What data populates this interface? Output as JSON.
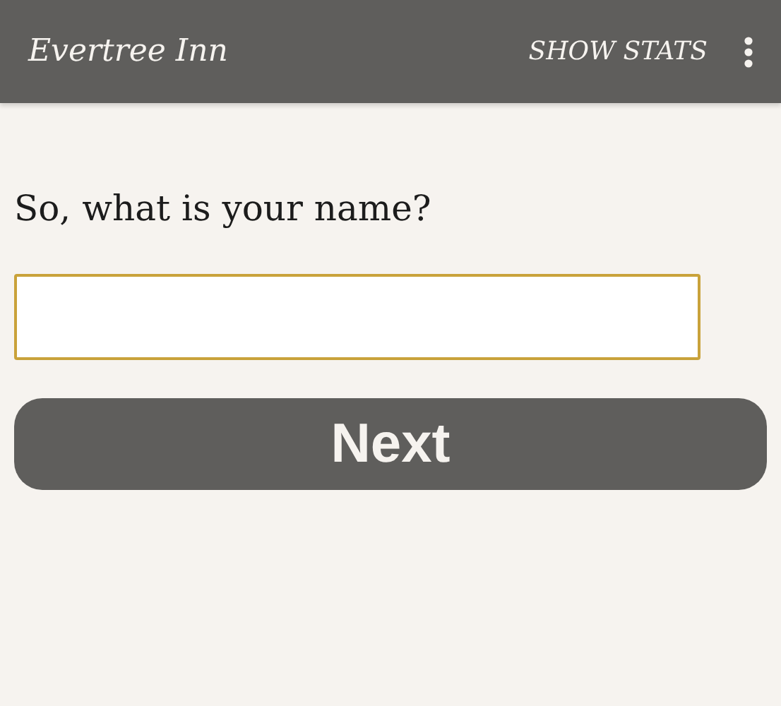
{
  "app_bar": {
    "title": "Evertree Inn",
    "action": "SHOW STATS"
  },
  "question": "So, what is your name?",
  "next_button": {
    "label": "Next"
  }
}
